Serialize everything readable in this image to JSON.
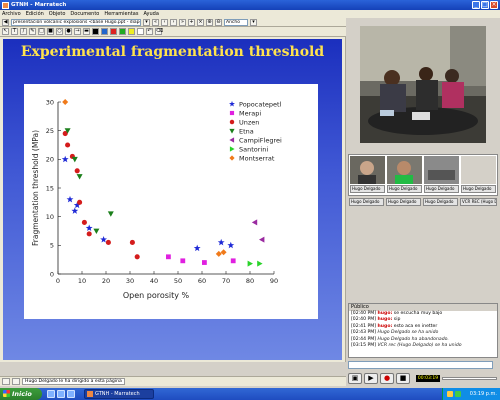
{
  "window": {
    "title": "GTNH - Marratech"
  },
  "menu": [
    "Archivo",
    "Edición",
    "Objeto",
    "Documento",
    "Herramientas",
    "Ayuda"
  ],
  "toolbar": {
    "document_field": "presentación volcanic explosions <base Hugo.ppt - diapo...",
    "zoom_value": "Ancho"
  },
  "slide": {
    "title": "Experimental fragmentation threshold"
  },
  "chart_data": {
    "type": "scatter",
    "xlabel": "Open porosity %",
    "ylabel": "Fragmentation threshold (MPa)",
    "xlim": [
      0,
      90
    ],
    "ylim": [
      0,
      30
    ],
    "xticks": [
      0,
      10,
      20,
      30,
      40,
      50,
      60,
      70,
      80,
      90
    ],
    "yticks": [
      0,
      5,
      10,
      15,
      20,
      25,
      30
    ],
    "legend_position": "top-right",
    "series": [
      {
        "name": "Popocatepetl",
        "marker": "star",
        "color": "#1f2ad6",
        "points": [
          [
            3,
            20
          ],
          [
            5,
            13
          ],
          [
            8,
            12
          ],
          [
            7,
            11
          ],
          [
            13,
            8
          ],
          [
            19,
            6
          ],
          [
            58,
            4.5
          ],
          [
            68,
            5.5
          ],
          [
            72,
            5
          ]
        ]
      },
      {
        "name": "Merapi",
        "marker": "square",
        "color": "#e020e0",
        "points": [
          [
            46,
            3
          ],
          [
            52,
            2.3
          ],
          [
            61,
            2
          ],
          [
            73,
            2.3
          ]
        ]
      },
      {
        "name": "Unzen",
        "marker": "circle",
        "color": "#d41c1c",
        "points": [
          [
            3,
            24.5
          ],
          [
            4,
            22.5
          ],
          [
            6,
            20.5
          ],
          [
            8,
            18
          ],
          [
            9,
            12.5
          ],
          [
            11,
            9
          ],
          [
            13,
            7
          ],
          [
            21,
            5.5
          ],
          [
            31,
            5.5
          ],
          [
            33,
            3
          ]
        ]
      },
      {
        "name": "Etna",
        "marker": "triangle-down",
        "color": "#1b7f1b",
        "points": [
          [
            4,
            25
          ],
          [
            7,
            20
          ],
          [
            9,
            17
          ],
          [
            16,
            7.5
          ],
          [
            22,
            10.5
          ]
        ]
      },
      {
        "name": "CampiFlegrei",
        "marker": "triangle-left",
        "color": "#9a2aa0",
        "points": [
          [
            82,
            9
          ],
          [
            85,
            6
          ]
        ]
      },
      {
        "name": "Santorini",
        "marker": "triangle-right",
        "color": "#2ad32a",
        "points": [
          [
            80,
            1.8
          ],
          [
            84,
            1.8
          ]
        ]
      },
      {
        "name": "Montserrat",
        "marker": "diamond",
        "color": "#f07a1a",
        "points": [
          [
            3,
            30
          ],
          [
            67,
            3.5
          ],
          [
            69,
            3.8
          ]
        ]
      }
    ]
  },
  "video": {
    "thumbnails": [
      {
        "label": "Hugo Delgado"
      },
      {
        "label": "Hugo Delgado"
      },
      {
        "label": "Hugo Delgado"
      },
      {
        "label": "Hugo Delgado"
      }
    ],
    "thumbnails_row2": [
      {
        "label": "Hugo Delgado"
      },
      {
        "label": "Hugo Delgado"
      },
      {
        "label": "Hugo Delgado"
      },
      {
        "label": "VCR REC (Hugo Delgado)"
      }
    ]
  },
  "chat": {
    "header": "Público",
    "messages": [
      {
        "time": "[02:40 PM]",
        "user": "hugo:",
        "text": "se escucha muy bajo"
      },
      {
        "time": "[02:40 PM]",
        "user": "hugo:",
        "text": "sip"
      },
      {
        "time": "[02:41 PM]",
        "user": "hugo:",
        "text": "esto aca en inetter"
      },
      {
        "time": "[02:43 PM]",
        "user": "",
        "text": "Hugo Delgado se ha unido"
      },
      {
        "time": "[02:44 PM]",
        "user": "",
        "text": "Hugo Delgado ha abandonado."
      },
      {
        "time": "[03:15 PM]",
        "user": "",
        "text": "VCR rec (Hugo Delgado) se ha unido"
      }
    ]
  },
  "media": {
    "timecode": "00:03:19"
  },
  "status": {
    "message": "Hugo Delgado le ha dirigido a esta página"
  },
  "taskbar": {
    "start_label": "Inicio",
    "app_label": "GTNH - Marratech",
    "clock": "03:19 p.m."
  }
}
